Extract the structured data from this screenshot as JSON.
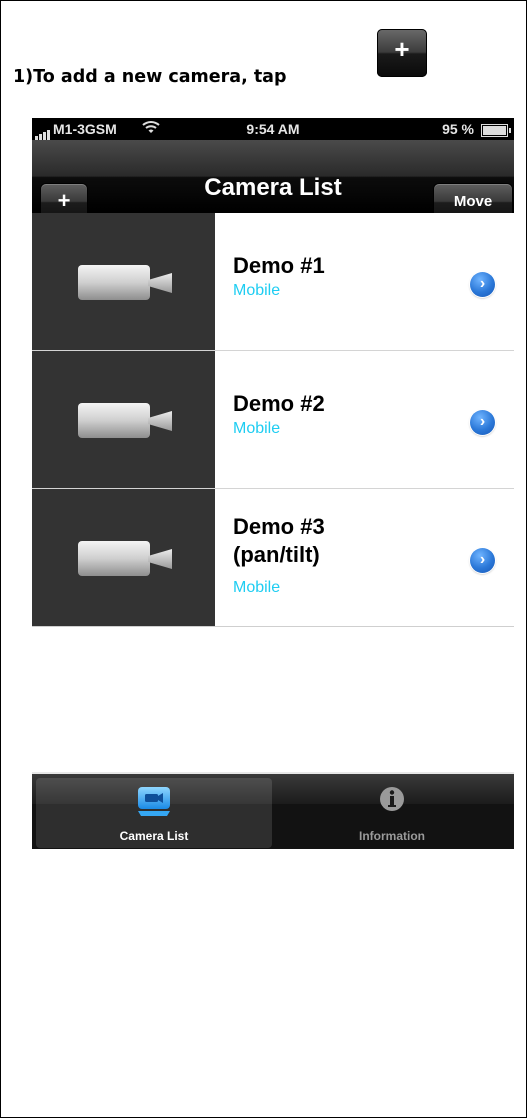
{
  "instruction": {
    "text": "1)To add a new camera, tap",
    "button_symbol": "+"
  },
  "status_bar": {
    "carrier": "M1-3GSM",
    "time": "9:54 AM",
    "battery": "95 %"
  },
  "nav_bar": {
    "title": "Camera List",
    "add_label": "+",
    "move_label": "Move"
  },
  "cameras": [
    {
      "name": "Demo #1",
      "type": "Mobile"
    },
    {
      "name": "Demo #2",
      "type": "Mobile"
    },
    {
      "name": "Demo #3 (pan/tilt)",
      "type": "Mobile"
    }
  ],
  "tab_bar": {
    "tabs": [
      {
        "label": "Camera List",
        "icon": "camera-list-icon",
        "selected": true
      },
      {
        "label": "Information",
        "icon": "info-icon",
        "selected": false
      }
    ]
  },
  "colors": {
    "subtitle": "#1ecdf2",
    "disclosure": "#2b78d8"
  }
}
